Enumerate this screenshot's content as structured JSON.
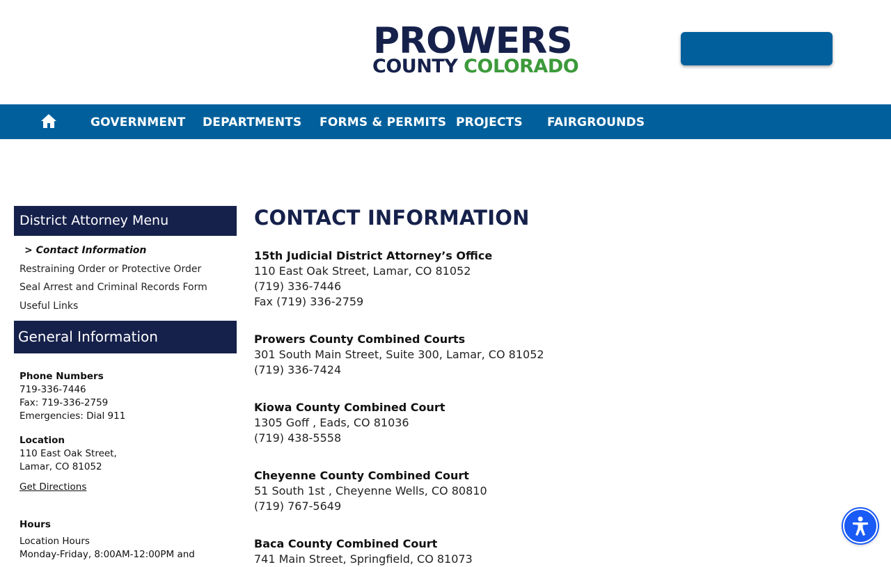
{
  "logo": {
    "line1": "PROWERS",
    "county": "COUNTY",
    "colorado": "COLORADO"
  },
  "nav": {
    "home_icon": "home-icon",
    "items": [
      "GOVERNMENT",
      "DEPARTMENTS",
      "FORMS & PERMITS",
      "PROJECTS",
      "FAIRGROUNDS"
    ]
  },
  "sidebar": {
    "menu_title": "District Attorney Menu",
    "links": [
      "> Contact Information",
      "Restraining Order or Protective Order",
      "Seal Arrest and Criminal Records Form",
      "Useful Links"
    ],
    "general_title": "General Information",
    "phone": {
      "title": "Phone Numbers",
      "lines": [
        "719-336-7446",
        "Fax: 719-336-2759",
        "Emergencies: Dial 911"
      ]
    },
    "location": {
      "title": "Location",
      "lines": [
        "110 East Oak Street,",
        "Lamar, CO 81052"
      ],
      "directions": "Get Directions"
    },
    "hours": {
      "title": "Hours",
      "lines": [
        "Location Hours",
        "Monday-Friday, 8:00AM-12:00PM and"
      ]
    }
  },
  "main": {
    "title": "CONTACT INFORMATION",
    "entries": [
      {
        "name": "15th Judicial District Attorney’s Office",
        "lines": [
          "110 East Oak Street, Lamar, CO 81052",
          "(719) 336-7446",
          "Fax (719) 336-2759"
        ]
      },
      {
        "name": "Prowers County Combined Courts",
        "lines": [
          "301 South Main Street, Suite 300, Lamar, CO 81052",
          "(719) 336-7424"
        ]
      },
      {
        "name": "Kiowa County Combined Court",
        "lines": [
          "1305 Goff , Eads, CO 81036",
          "(719) 438-5558"
        ]
      },
      {
        "name": "Cheyenne County Combined Court",
        "lines": [
          "51 South 1st , Cheyenne Wells, CO 80810",
          "(719) 767-5649"
        ]
      },
      {
        "name": "Baca County Combined Court",
        "lines": [
          "741 Main Street, Springfield, CO 81073"
        ]
      }
    ]
  },
  "accessibility": {
    "icon": "accessibility-icon"
  },
  "colors": {
    "navy": "#16214b",
    "green": "#3c9a3a",
    "nav_blue": "#01609c",
    "accessibility_blue": "#1a5af5"
  }
}
